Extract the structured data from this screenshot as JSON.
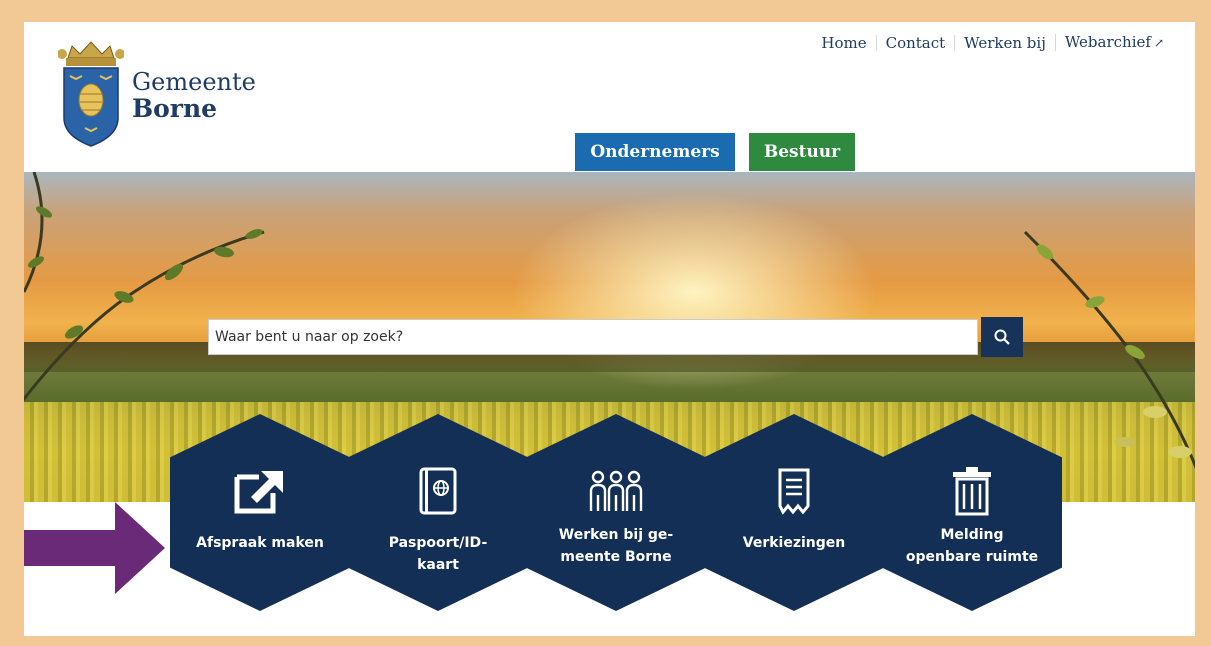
{
  "brand": {
    "line1": "Gemeente",
    "line2": "Borne"
  },
  "topnav": {
    "items": [
      "Home",
      "Contact",
      "Werken bij",
      "Webarchief"
    ]
  },
  "tabs": {
    "ondernemers": "Ondernemers",
    "bestuur": "Bestuur"
  },
  "search": {
    "placeholder": "Waar bent u naar op zoek?"
  },
  "tiles": [
    {
      "label": "Afspraak maken",
      "icon": "external-link-icon"
    },
    {
      "label": "Paspoort/ID-kaart",
      "icon": "passport-icon"
    },
    {
      "label": "Werken bij ge-meente Borne",
      "icon": "people-icon"
    },
    {
      "label": "Verkiezingen",
      "icon": "ballot-icon"
    },
    {
      "label": "Melding openbare ruimte",
      "icon": "trash-icon"
    }
  ],
  "colors": {
    "navy": "#142f55",
    "blue": "#1a6bb0",
    "green": "#2e8a3f",
    "frame": "#f2c994",
    "arrow": "#6a2a78"
  }
}
